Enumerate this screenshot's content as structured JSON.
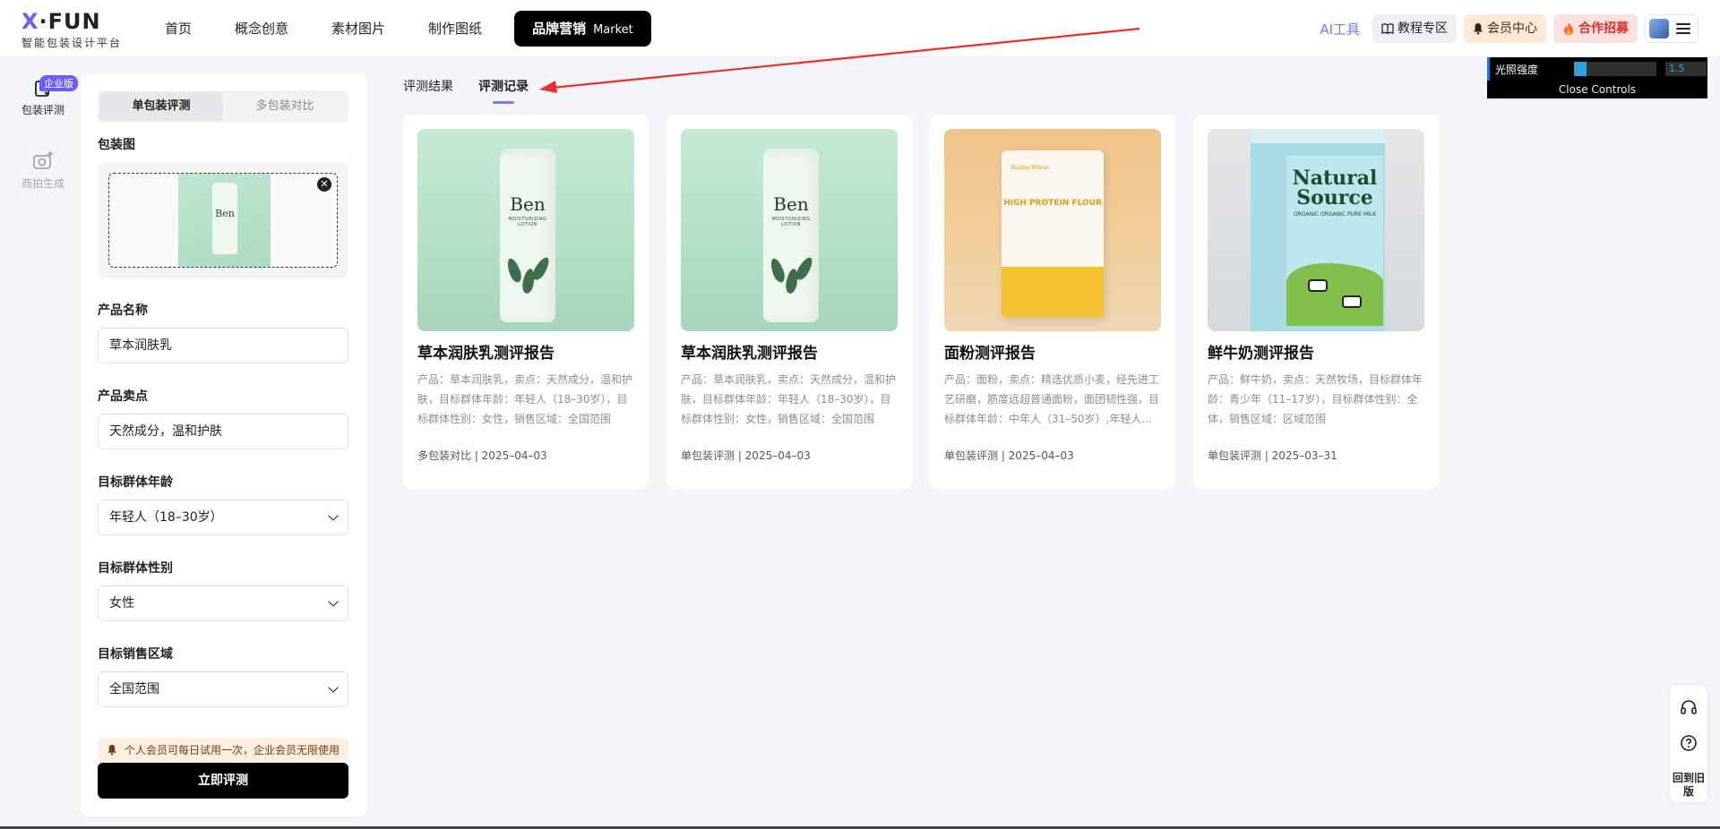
{
  "header": {
    "logo_main_x": "X",
    "logo_main_rest": "·FUN",
    "logo_sub": "智能包装设计平台",
    "nav": [
      "首页",
      "概念创意",
      "素材图片",
      "制作图纸"
    ],
    "nav_active": "品牌营销",
    "nav_active_suffix": "Market",
    "ai_tools": "AI工具",
    "tutorial": "教程专区",
    "member_center": "会员中心",
    "cooperation": "合作招募"
  },
  "rail": {
    "item1": "包装评测",
    "item1_badge": "企业版",
    "item2": "商拍生成"
  },
  "form": {
    "seg_single": "单包装评测",
    "seg_multi": "多包装对比",
    "label_image": "包装图",
    "thumb_brand": "Ben",
    "label_name": "产品名称",
    "value_name": "草本润肤乳",
    "label_selling": "产品卖点",
    "value_selling": "天然成分，温和护肤",
    "label_age": "目标群体年龄",
    "value_age": "年轻人（18–30岁）",
    "label_gender": "目标群体性别",
    "value_gender": "女性",
    "label_region": "目标销售区域",
    "value_region": "全国范围",
    "tip": "个人会员可每日试用一次，企业会员无限使用",
    "submit": "立即评测"
  },
  "tabs": [
    "评测结果",
    "评测记录"
  ],
  "cards": [
    {
      "title": "草本润肤乳测评报告",
      "desc": "产品：草本润肤乳，卖点：天然成分，温和护肤，目标群体年龄：年轻人（18–30岁），目标群体性别：女性，销售区域：全国范围",
      "meta": "多包装对比 | 2025–04–03",
      "img_brand": "Ben",
      "img_sub": "MOISTURIZING LOTION"
    },
    {
      "title": "草本润肤乳测评报告",
      "desc": "产品：草本润肤乳，卖点：天然成分，温和护肤，目标群体年龄：年轻人（18–30岁），目标群体性别：女性，销售区域：全国范围",
      "meta": "单包装评测 | 2025–04–03",
      "img_brand": "Ben",
      "img_sub": "MOISTURIZING LOTION"
    },
    {
      "title": "面粉测评报告",
      "desc": "产品：面粉，卖点：精选优质小麦，经先进工艺研磨，筋度远超普通面粉，面团韧性强，目标群体年龄：中年人（31–50岁）,年轻人...",
      "meta": "单包装评测 | 2025–04–03",
      "img_brand": "Baking Wheat",
      "img_sub": "HIGH PROTEIN FLOUR"
    },
    {
      "title": "鲜牛奶测评报告",
      "desc": "产品：鲜牛奶，卖点：天然牧场，目标群体年龄：青少年（11–17岁），目标群体性别：全体，销售区域：区域范围",
      "meta": "单包装评测 | 2025–03–31",
      "img_brand": "Natural Source",
      "img_sub": "ORGANIC ORGANIC PURE MILK"
    }
  ],
  "controls": {
    "label": "光照强度",
    "value": "1.5",
    "level": 0.15,
    "close": "Close Controls"
  },
  "float": {
    "back": "回到旧版"
  },
  "colors": {
    "accent": "#6b5cff",
    "arrow": "#e8302a"
  }
}
